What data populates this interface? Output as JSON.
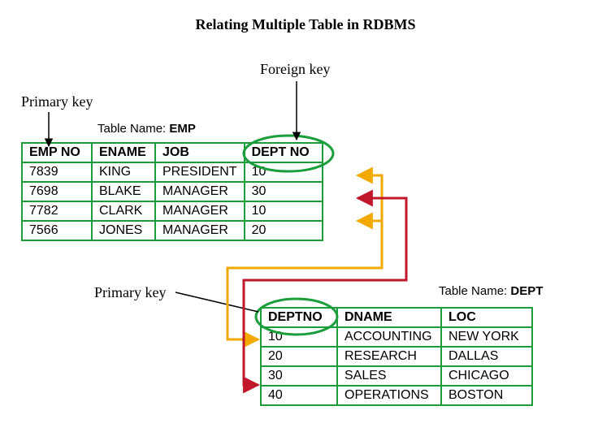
{
  "title": "Relating Multiple Table in RDBMS",
  "labels": {
    "foreign_key": "Foreign key",
    "primary_key_1": "Primary key",
    "primary_key_2": "Primary key"
  },
  "emp_table": {
    "caption_prefix": "Table Name: ",
    "caption_name": "EMP",
    "headers": {
      "c1": "EMP NO",
      "c2": "ENAME",
      "c3": "JOB",
      "c4": "DEPT NO"
    },
    "rows": [
      {
        "c1": "7839",
        "c2": "KING",
        "c3": "PRESIDENT",
        "c4": "10"
      },
      {
        "c1": "7698",
        "c2": "BLAKE",
        "c3": "MANAGER",
        "c4": "30"
      },
      {
        "c1": "7782",
        "c2": "CLARK",
        "c3": "MANAGER",
        "c4": "10"
      },
      {
        "c1": "7566",
        "c2": "JONES",
        "c3": "MANAGER",
        "c4": "20"
      }
    ]
  },
  "dept_table": {
    "caption_prefix": "Table Name: ",
    "caption_name": "DEPT",
    "headers": {
      "c1": "DEPTNO",
      "c2": "DNAME",
      "c3": "LOC"
    },
    "rows": [
      {
        "c1": "10",
        "c2": "ACCOUNTING",
        "c3": "NEW YORK"
      },
      {
        "c1": "20",
        "c2": "RESEARCH",
        "c3": "DALLAS"
      },
      {
        "c1": "30",
        "c2": "SALES",
        "c3": "CHICAGO"
      },
      {
        "c1": "40",
        "c2": "OPERATIONS",
        "c3": "BOSTON"
      }
    ]
  }
}
